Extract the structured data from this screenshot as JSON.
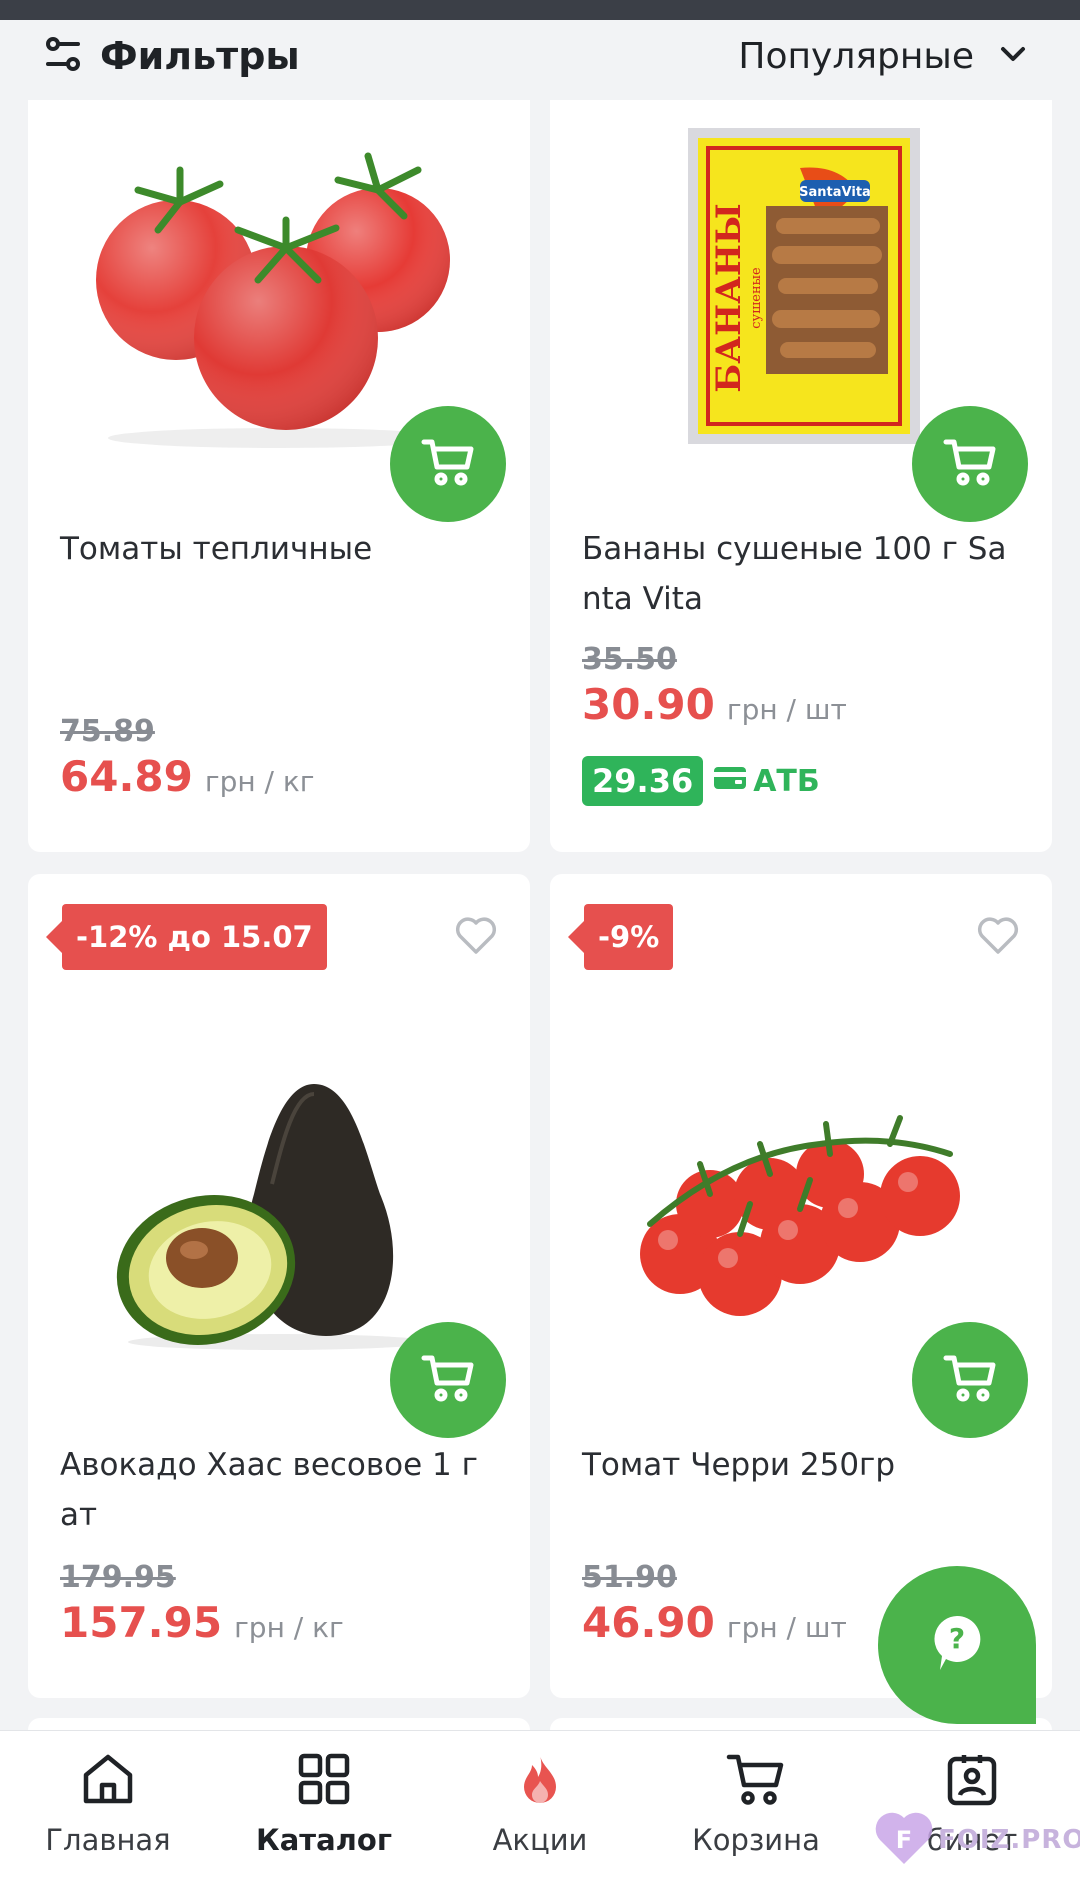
{
  "header": {
    "filters_label": "Фильтры",
    "sort_label": "Популярные"
  },
  "products": [
    {
      "name": "Томаты тепличные",
      "old_price": "75.89",
      "price": "64.89",
      "unit": "грн / кг",
      "image_icon": "tomatoes-image"
    },
    {
      "name": "Бананы сушеные 100 г Sa nta Vita",
      "old_price": "35.50",
      "price": "30.90",
      "unit": "грн / шт",
      "card_price": "29.36",
      "card_label": "АТБ",
      "image_icon": "dried-bananas-package-image",
      "package_brand": "SantaVita",
      "package_title": "БАНАНЫ",
      "package_subtitle": "сушеные"
    },
    {
      "name": "Авокадо Хаас весовое 1 г ат",
      "old_price": "179.95",
      "price": "157.95",
      "unit": "грн / кг",
      "discount": "-12% до 15.07",
      "image_icon": "avocado-image"
    },
    {
      "name": "Томат Черри 250гр",
      "old_price": "51.90",
      "price": "46.90",
      "unit": "грн / шт",
      "discount": "-9%",
      "image_icon": "cherry-tomatoes-image"
    }
  ],
  "nav": [
    {
      "label": "Главная",
      "icon": "home-icon"
    },
    {
      "label": "Каталог",
      "icon": "catalog-grid-icon",
      "active": true
    },
    {
      "label": "Акции",
      "icon": "flame-icon"
    },
    {
      "label": "Корзина",
      "icon": "cart-icon"
    },
    {
      "label": "бинет",
      "icon": "profile-badge-icon"
    }
  ],
  "watermark": "FOIZ.PRO",
  "colors": {
    "accent_green": "#4bb34b",
    "price_red": "#e6504e",
    "atb_green": "#2fb45a",
    "flame_red": "#e85450"
  }
}
